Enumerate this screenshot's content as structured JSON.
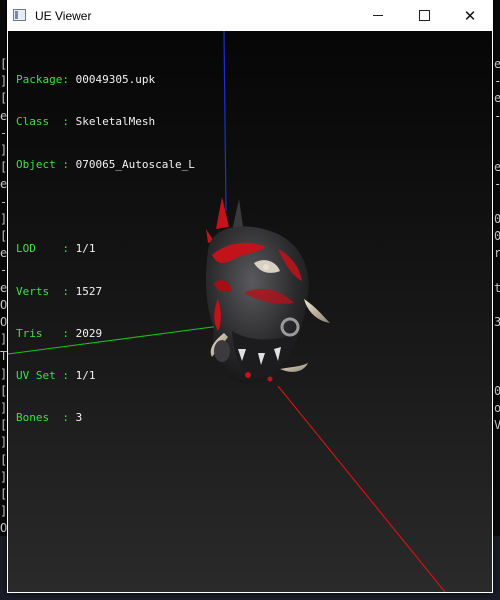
{
  "window": {
    "title": "UE Viewer",
    "close_glyph": "✕"
  },
  "info": [
    {
      "label": "Package",
      "sep": ": ",
      "value": "00049305.upk"
    },
    {
      "label": "Class  ",
      "sep": ": ",
      "value": "SkeletalMesh"
    },
    {
      "label": "Object ",
      "sep": ": ",
      "value": "070065_Autoscale_L"
    },
    {
      "label": "LOD    ",
      "sep": ": ",
      "value": "1/1"
    },
    {
      "label": "Verts  ",
      "sep": ": ",
      "value": "1527"
    },
    {
      "label": "Tris   ",
      "sep": ": ",
      "value": "2029"
    },
    {
      "label": "UV Set ",
      "sep": ": ",
      "value": "1/1"
    },
    {
      "label": "Bones  ",
      "sep": ": ",
      "value": "3"
    }
  ],
  "colors": {
    "label": "#3fe043",
    "value": "#f2f2f2",
    "axis_x": "#e01010",
    "axis_y": "#19c419",
    "axis_z": "#1c2fd9",
    "mesh_dark": "#2b2b2d",
    "mesh_red": "#c2121a"
  },
  "background_console": {
    "left": [
      "[",
      "]",
      "[",
      "e",
      "-",
      "]",
      "[",
      "e",
      "-",
      "]",
      "[",
      "e",
      "-",
      "e",
      "O",
      "O",
      "]",
      "T",
      "]",
      "[",
      "]",
      "[",
      "]",
      "[",
      "]",
      "[",
      "]",
      "O",
      "[",
      "e",
      "]"
    ],
    "right": [
      "e",
      "-",
      "e",
      "-",
      "",
      "",
      "e",
      "-",
      "",
      "0",
      "0",
      "r",
      "",
      "t",
      "",
      "3",
      "",
      "",
      "",
      "0",
      "o",
      "V"
    ]
  }
}
